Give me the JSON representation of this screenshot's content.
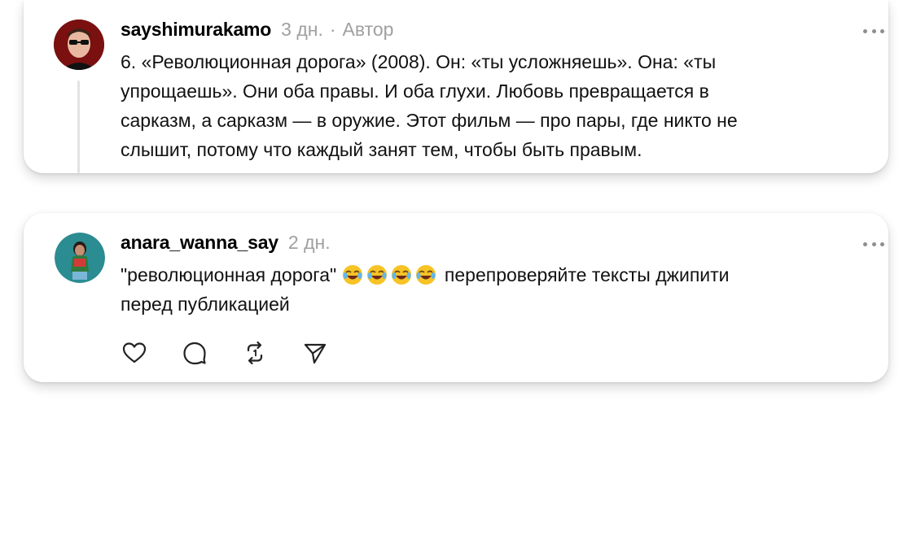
{
  "comments": [
    {
      "username": "sayshimurakamo",
      "time": "3 дн.",
      "separator": "·",
      "role": "Автор",
      "lines": [
        "6. «Революционная дорога» (2008). Он: «ты усложняешь». Она: «ты",
        "упрощаешь». Они оба правы. И оба глухи. Любовь превращается в",
        "сарказм, а сарказм — в оружие. Этот фильм — про пары, где никто не",
        "слышит, потому что каждый занят тем, чтобы быть правым."
      ]
    },
    {
      "username": "anara_wanna_say",
      "time": "2 дн.",
      "line1_before": "\"революционная дорога\" ",
      "line1_after": " перепроверяйте тексты джипити",
      "line2": "перед публикацией",
      "emoji_count": 4
    }
  ],
  "icons": {
    "more": "more-horizontal-icon",
    "like": "heart-icon",
    "reply": "comment-icon",
    "repost": "repost-icon",
    "share": "send-icon"
  },
  "colors": {
    "meta_text": "#a0a0a0",
    "thread_line": "#e3e3e3"
  }
}
